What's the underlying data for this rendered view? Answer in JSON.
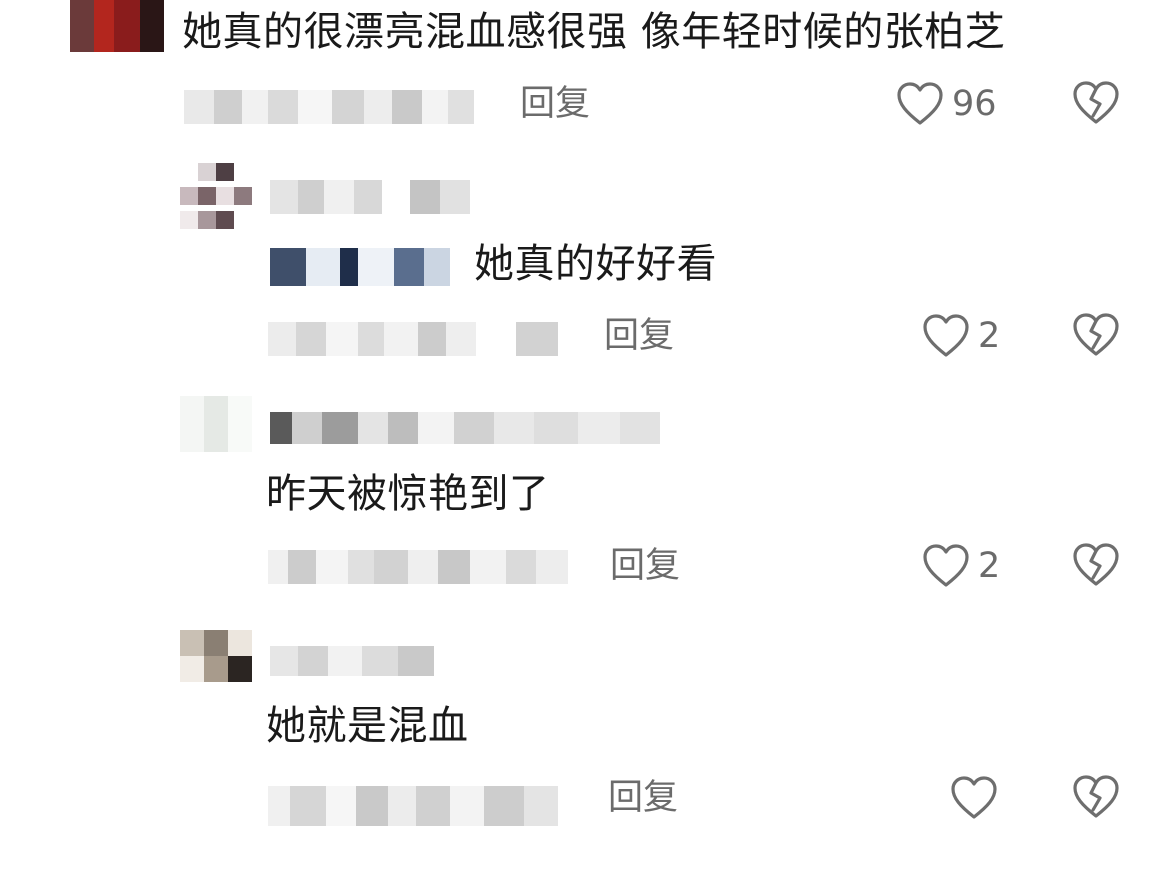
{
  "comments": [
    {
      "text": "她真的很漂亮混血感很强 像年轻时候的张柏芝",
      "reply_label": "回复",
      "like_count": "96"
    },
    {
      "text": "她真的好好看",
      "reply_label": "回复",
      "like_count": "2"
    },
    {
      "text": "昨天被惊艳到了",
      "reply_label": "回复",
      "like_count": "2"
    },
    {
      "text": "她就是混血",
      "reply_label": "回复",
      "like_count": ""
    }
  ],
  "icons": {
    "like": "heart-outline-icon",
    "dislike": "broken-heart-icon"
  },
  "colors": {
    "text": "#1a1a1a",
    "secondary": "#6b6b6b",
    "icon": "#6e6e6e",
    "background": "#ffffff"
  }
}
